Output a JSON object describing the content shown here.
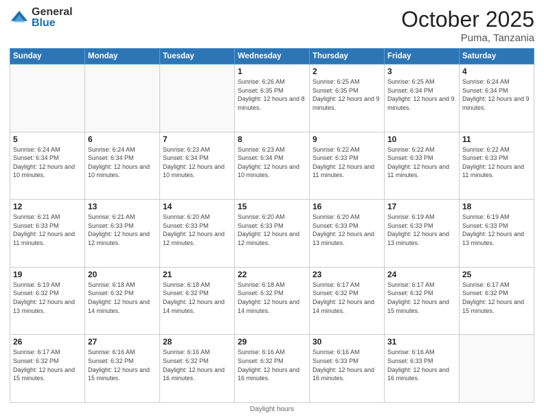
{
  "header": {
    "logo_general": "General",
    "logo_blue": "Blue",
    "month_title": "October 2025",
    "subtitle": "Puma, Tanzania"
  },
  "days_of_week": [
    "Sunday",
    "Monday",
    "Tuesday",
    "Wednesday",
    "Thursday",
    "Friday",
    "Saturday"
  ],
  "weeks": [
    [
      {
        "day": "",
        "info": ""
      },
      {
        "day": "",
        "info": ""
      },
      {
        "day": "",
        "info": ""
      },
      {
        "day": "1",
        "info": "Sunrise: 6:26 AM\nSunset: 6:35 PM\nDaylight: 12 hours and 8 minutes."
      },
      {
        "day": "2",
        "info": "Sunrise: 6:25 AM\nSunset: 6:35 PM\nDaylight: 12 hours and 9 minutes."
      },
      {
        "day": "3",
        "info": "Sunrise: 6:25 AM\nSunset: 6:34 PM\nDaylight: 12 hours and 9 minutes."
      },
      {
        "day": "4",
        "info": "Sunrise: 6:24 AM\nSunset: 6:34 PM\nDaylight: 12 hours and 9 minutes."
      }
    ],
    [
      {
        "day": "5",
        "info": "Sunrise: 6:24 AM\nSunset: 6:34 PM\nDaylight: 12 hours and 10 minutes."
      },
      {
        "day": "6",
        "info": "Sunrise: 6:24 AM\nSunset: 6:34 PM\nDaylight: 12 hours and 10 minutes."
      },
      {
        "day": "7",
        "info": "Sunrise: 6:23 AM\nSunset: 6:34 PM\nDaylight: 12 hours and 10 minutes."
      },
      {
        "day": "8",
        "info": "Sunrise: 6:23 AM\nSunset: 6:34 PM\nDaylight: 12 hours and 10 minutes."
      },
      {
        "day": "9",
        "info": "Sunrise: 6:22 AM\nSunset: 6:33 PM\nDaylight: 12 hours and 11 minutes."
      },
      {
        "day": "10",
        "info": "Sunrise: 6:22 AM\nSunset: 6:33 PM\nDaylight: 12 hours and 11 minutes."
      },
      {
        "day": "11",
        "info": "Sunrise: 6:22 AM\nSunset: 6:33 PM\nDaylight: 12 hours and 11 minutes."
      }
    ],
    [
      {
        "day": "12",
        "info": "Sunrise: 6:21 AM\nSunset: 6:33 PM\nDaylight: 12 hours and 11 minutes."
      },
      {
        "day": "13",
        "info": "Sunrise: 6:21 AM\nSunset: 6:33 PM\nDaylight: 12 hours and 12 minutes."
      },
      {
        "day": "14",
        "info": "Sunrise: 6:20 AM\nSunset: 6:33 PM\nDaylight: 12 hours and 12 minutes."
      },
      {
        "day": "15",
        "info": "Sunrise: 6:20 AM\nSunset: 6:33 PM\nDaylight: 12 hours and 12 minutes."
      },
      {
        "day": "16",
        "info": "Sunrise: 6:20 AM\nSunset: 6:33 PM\nDaylight: 12 hours and 13 minutes."
      },
      {
        "day": "17",
        "info": "Sunrise: 6:19 AM\nSunset: 6:33 PM\nDaylight: 12 hours and 13 minutes."
      },
      {
        "day": "18",
        "info": "Sunrise: 6:19 AM\nSunset: 6:33 PM\nDaylight: 12 hours and 13 minutes."
      }
    ],
    [
      {
        "day": "19",
        "info": "Sunrise: 6:19 AM\nSunset: 6:32 PM\nDaylight: 12 hours and 13 minutes."
      },
      {
        "day": "20",
        "info": "Sunrise: 6:18 AM\nSunset: 6:32 PM\nDaylight: 12 hours and 14 minutes."
      },
      {
        "day": "21",
        "info": "Sunrise: 6:18 AM\nSunset: 6:32 PM\nDaylight: 12 hours and 14 minutes."
      },
      {
        "day": "22",
        "info": "Sunrise: 6:18 AM\nSunset: 6:32 PM\nDaylight: 12 hours and 14 minutes."
      },
      {
        "day": "23",
        "info": "Sunrise: 6:17 AM\nSunset: 6:32 PM\nDaylight: 12 hours and 14 minutes."
      },
      {
        "day": "24",
        "info": "Sunrise: 6:17 AM\nSunset: 6:32 PM\nDaylight: 12 hours and 15 minutes."
      },
      {
        "day": "25",
        "info": "Sunrise: 6:17 AM\nSunset: 6:32 PM\nDaylight: 12 hours and 15 minutes."
      }
    ],
    [
      {
        "day": "26",
        "info": "Sunrise: 6:17 AM\nSunset: 6:32 PM\nDaylight: 12 hours and 15 minutes."
      },
      {
        "day": "27",
        "info": "Sunrise: 6:16 AM\nSunset: 6:32 PM\nDaylight: 12 hours and 15 minutes."
      },
      {
        "day": "28",
        "info": "Sunrise: 6:16 AM\nSunset: 6:32 PM\nDaylight: 12 hours and 16 minutes."
      },
      {
        "day": "29",
        "info": "Sunrise: 6:16 AM\nSunset: 6:32 PM\nDaylight: 12 hours and 16 minutes."
      },
      {
        "day": "30",
        "info": "Sunrise: 6:16 AM\nSunset: 6:33 PM\nDaylight: 12 hours and 16 minutes."
      },
      {
        "day": "31",
        "info": "Sunrise: 6:16 AM\nSunset: 6:33 PM\nDaylight: 12 hours and 16 minutes."
      },
      {
        "day": "",
        "info": ""
      }
    ]
  ],
  "footer": {
    "note": "Daylight hours"
  }
}
